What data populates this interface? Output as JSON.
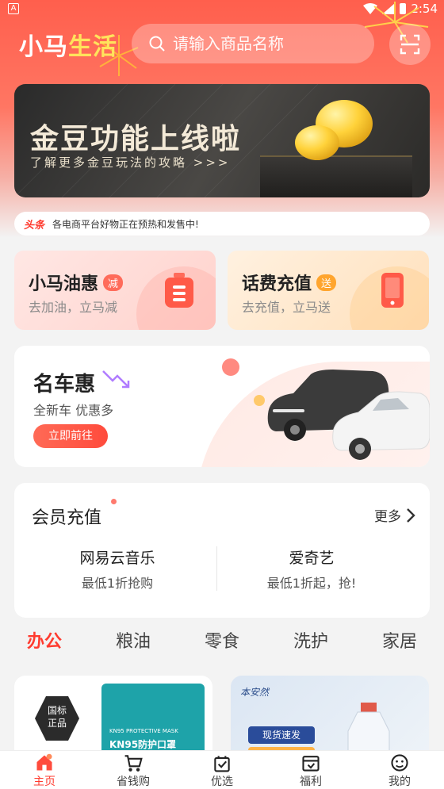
{
  "status": {
    "time": "2:54",
    "left_badge": "A"
  },
  "header": {
    "logo_main": "小马",
    "logo_accent": "生活",
    "search_placeholder": "请输入商品名称"
  },
  "banner": {
    "title": "金豆功能上线啦",
    "subtitle": "了解更多金豆玩法的攻略 >>>"
  },
  "news": {
    "tag": "头条",
    "text": "各电商平台好物正在预热和发售中!"
  },
  "cards": [
    {
      "title": "小马油惠",
      "badge": "减",
      "desc": "去加油，立马减",
      "accent": "#ff6b5a"
    },
    {
      "title": "话费充值",
      "badge": "送",
      "desc": "去充值，立马送",
      "accent": "#ffa52e"
    }
  ],
  "car": {
    "title": "名车惠",
    "subtitle": "全新车 优惠多",
    "button": "立即前往"
  },
  "member": {
    "title": "会员充值",
    "more": "更多",
    "items": [
      {
        "name": "网易云音乐",
        "desc": "最低1折抢购"
      },
      {
        "name": "爱奇艺",
        "desc": "最低1折起，抢!"
      }
    ]
  },
  "categories": [
    "办公",
    "粮油",
    "零食",
    "洗护",
    "家居"
  ],
  "products": {
    "left_badge_line1": "国标",
    "left_badge_line2": "正品",
    "left_brand": "KN95 PROTECTIVE MASK",
    "left_name": "KN95防护口罩",
    "right_brand": "本安然",
    "right_tag": "现货速发"
  },
  "tabs": [
    {
      "label": "主页",
      "icon": "home-icon"
    },
    {
      "label": "省钱购",
      "icon": "cart-icon"
    },
    {
      "label": "优选",
      "icon": "bag-icon"
    },
    {
      "label": "福利",
      "icon": "gift-icon"
    },
    {
      "label": "我的",
      "icon": "profile-icon"
    }
  ],
  "colors": {
    "primary": "#ff4b3c",
    "header": "#ff6a57"
  }
}
